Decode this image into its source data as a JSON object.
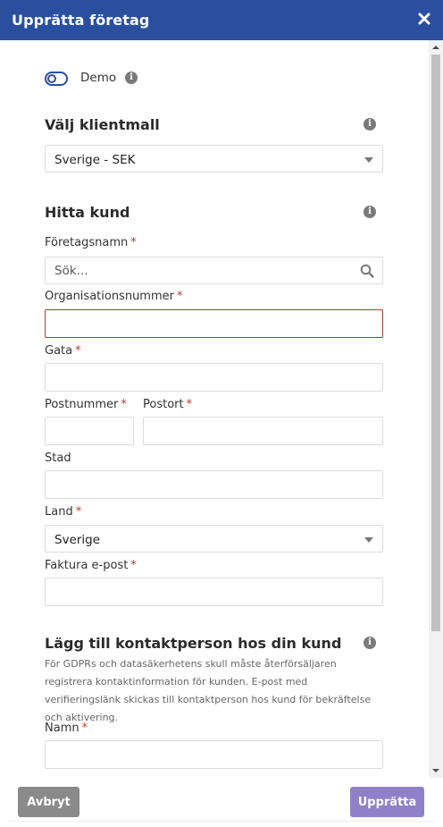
{
  "header": {
    "title": "Upprätta företag",
    "close_icon": "close-icon"
  },
  "demo": {
    "label": "Demo",
    "enabled": false
  },
  "template": {
    "title": "Välj klientmall",
    "selected": "Sverige - SEK"
  },
  "customer": {
    "title": "Hitta kund",
    "company_name_label": "Företagsnamn",
    "search_placeholder": "Sök...",
    "org_number_label": "Organisationsnummer",
    "street_label": "Gata",
    "postal_code_label": "Postnummer",
    "city_label": "Postort",
    "town_label": "Stad",
    "country_label": "Land",
    "country_selected": "Sverige",
    "invoice_email_label": "Faktura e-post",
    "required_marker": "*"
  },
  "contact": {
    "title": "Lägg till kontaktperson hos din kund",
    "note": "För GDPRs och datasäkerhetens skull måste återförsäljaren registrera kontaktinformation för kunden. E-post med verifieringslänk skickas till kontaktperson hos kund för bekräftelse och aktivering.",
    "name_label": "Namn"
  },
  "footer": {
    "cancel_label": "Avbryt",
    "submit_label": "Upprätta"
  },
  "colors": {
    "header_bg": "#2b4f9f",
    "required": "#c0392b",
    "error_border": "#b03a2e",
    "cancel_bg": "#8a8a8a",
    "submit_bg": "#8e81c9"
  }
}
